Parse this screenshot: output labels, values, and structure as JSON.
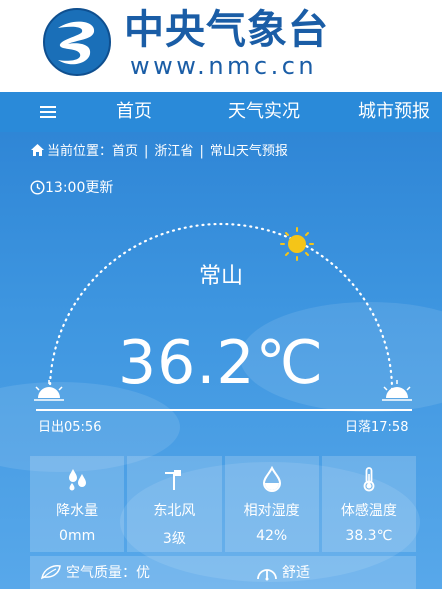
{
  "header": {
    "brand_name": "中央气象台",
    "url": "www.nmc.cn",
    "logo_icon": "cma-logo-icon"
  },
  "nav": {
    "menu_icon": "hamburger-icon",
    "items": [
      {
        "label": "首页"
      },
      {
        "label": "天气实况"
      },
      {
        "label": "城市预报"
      }
    ]
  },
  "breadcrumb": {
    "prefix": "当前位置：",
    "items": [
      "首页",
      "浙江省",
      "常山天气预报"
    ],
    "separator": "|"
  },
  "update_time": "13:00更新",
  "weather": {
    "city": "常山",
    "temperature": "36.2℃",
    "sunrise": "日出05:56",
    "sunset": "日落17:58"
  },
  "stats": [
    {
      "icon": "rain-drops-icon",
      "label": "降水量",
      "value": "0mm"
    },
    {
      "icon": "wind-vane-icon",
      "label": "东北风",
      "value": "3级"
    },
    {
      "icon": "humidity-drop-icon",
      "label": "相对湿度",
      "value": "42%"
    },
    {
      "icon": "thermometer-icon",
      "label": "体感温度",
      "value": "38.3℃"
    }
  ],
  "footer": {
    "air_quality": "空气质量：优",
    "comfort": "舒适"
  },
  "colors": {
    "brand": "#1a5da6",
    "nav": "#2a8ad9",
    "sky": "#3e96e0",
    "sun": "#f5c518"
  }
}
